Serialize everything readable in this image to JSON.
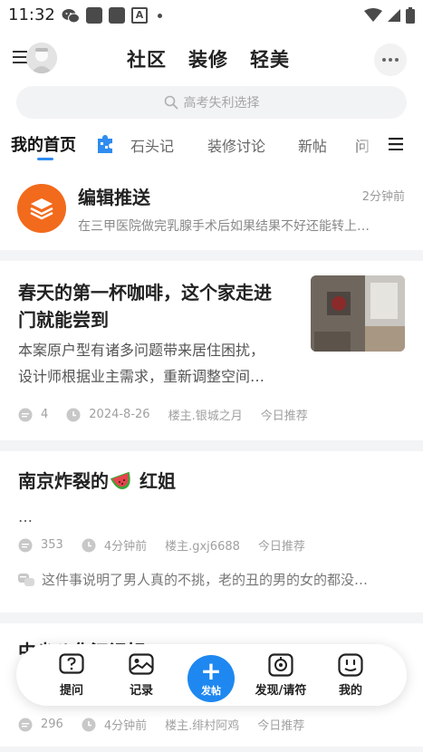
{
  "status_bar": {
    "time": "11:32",
    "mini_label": "A"
  },
  "top_bar": {
    "tabs": [
      "社区",
      "装修",
      "轻美"
    ]
  },
  "search": {
    "placeholder": "高考失利选择"
  },
  "channels": {
    "tabs": [
      "我的首页",
      "石头记",
      "装修讨论",
      "新帖",
      "问"
    ],
    "active": 0
  },
  "editor_push": {
    "title": "编辑推送",
    "time": "2分钟前",
    "subtitle": "在三甲医院做完乳腺手术后如果结果不好还能转上…"
  },
  "posts": [
    {
      "title_line1": "春天的第一杯咖啡，这个家走进",
      "title_line2": "门就能尝到",
      "body_line1": "本案原户型有诸多问题带来居住困扰，",
      "body_line2": "设计师根据业主需求，重新调整空间…",
      "comments": "4",
      "time": "2024-8-26",
      "author": "楼主.银城之月",
      "tag": "今日推荐"
    },
    {
      "title_prefix": "南京炸裂的",
      "title_suffix": "红姐",
      "body_line1": "…",
      "comments": "353",
      "time": "4分钟前",
      "author": "楼主.gxj6688",
      "tag": "今日推荐",
      "hot_comment": "这件事说明了男人真的不挑，老的丑的男的女的都没…"
    },
    {
      "title_partial": "中尖八化江记轩",
      "comments": "296",
      "time": "4分钟前",
      "author": "楼主.绯村阿鸡",
      "tag": "今日推荐"
    }
  ],
  "bottom_nav": {
    "items": [
      {
        "label": "提问",
        "icon": "question-icon"
      },
      {
        "label": "记录",
        "icon": "photo-icon"
      },
      {
        "label": "发帖",
        "icon": "plus-icon"
      },
      {
        "label": "发现/请符",
        "icon": "discover-icon"
      },
      {
        "label": "我的",
        "icon": "profile-icon"
      }
    ]
  },
  "colors": {
    "accent": "#1e88f0",
    "editor_orange": "#f26a1b",
    "separator": "#f3f4f6"
  }
}
